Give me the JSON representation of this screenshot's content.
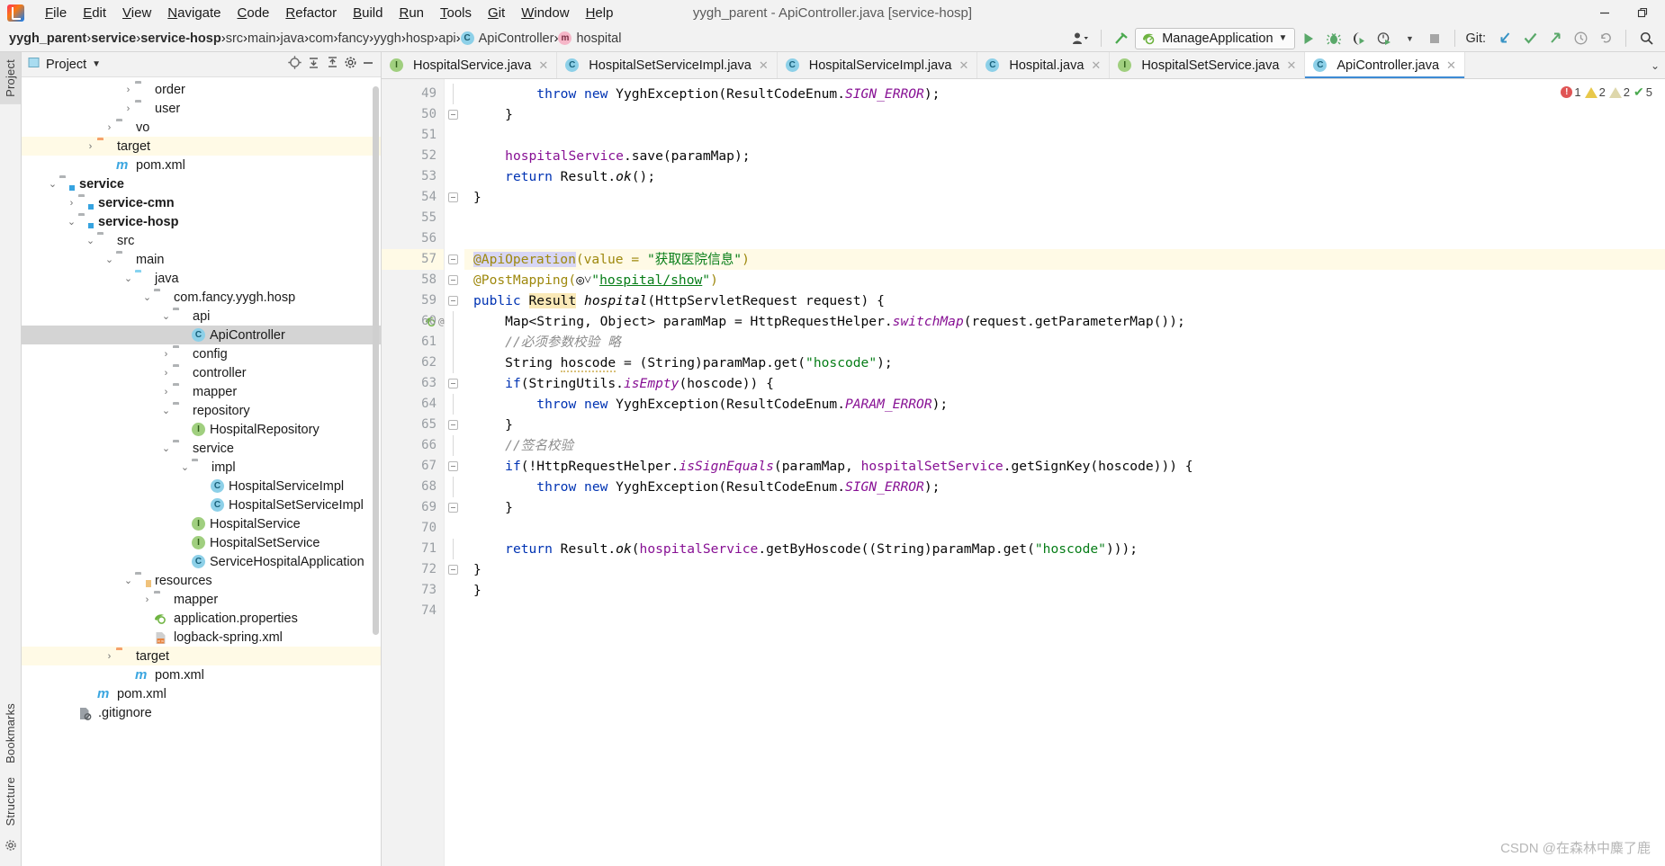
{
  "window": {
    "title": "yygh_parent - ApiController.java [service-hosp]",
    "minimize": "—",
    "maximize": "❐"
  },
  "menu": [
    "File",
    "Edit",
    "View",
    "Navigate",
    "Code",
    "Refactor",
    "Build",
    "Run",
    "Tools",
    "Git",
    "Window",
    "Help"
  ],
  "breadcrumb": [
    {
      "label": "yygh_parent",
      "bold": true
    },
    {
      "label": "service",
      "bold": true
    },
    {
      "label": "service-hosp",
      "bold": true
    },
    {
      "label": "src",
      "bold": false
    },
    {
      "label": "main",
      "bold": false
    },
    {
      "label": "java",
      "bold": false
    },
    {
      "label": "com",
      "bold": false
    },
    {
      "label": "fancy",
      "bold": false
    },
    {
      "label": "yygh",
      "bold": false
    },
    {
      "label": "hosp",
      "bold": false
    },
    {
      "label": "api",
      "bold": false
    },
    {
      "label": "ApiController",
      "bold": false,
      "icon": "class-icon"
    },
    {
      "label": "hospital",
      "bold": false,
      "icon": "method-icon"
    }
  ],
  "toolbar": {
    "run_config": "ManageApplication",
    "git_label": "Git:",
    "icons": [
      "person-dropdown-icon",
      "build-hammer-icon",
      "run-icon",
      "debug-icon",
      "run-coverage-icon",
      "profiler-icon",
      "dropdown-icon",
      "stop-icon",
      "git-update-icon",
      "git-commit-icon",
      "git-push-icon",
      "history-icon",
      "rollback-icon",
      "search-icon"
    ]
  },
  "project_panel": {
    "title": "Project",
    "tools": [
      "locate-icon",
      "collapse-all-icon",
      "expand-all-icon",
      "settings-icon",
      "hide-icon"
    ],
    "tree": [
      {
        "label": "order",
        "indent": 5,
        "type": "pkg",
        "arrow": "right"
      },
      {
        "label": "user",
        "indent": 5,
        "type": "pkg",
        "arrow": "right"
      },
      {
        "label": "vo",
        "indent": 4,
        "type": "pkg",
        "arrow": "right"
      },
      {
        "label": "target",
        "indent": 3,
        "type": "folder-orange",
        "arrow": "right",
        "highlight": true
      },
      {
        "label": "pom.xml",
        "indent": 4,
        "type": "maven",
        "arrow": "none"
      },
      {
        "label": "service",
        "indent": 1,
        "type": "module",
        "arrow": "down",
        "bold": true
      },
      {
        "label": "service-cmn",
        "indent": 2,
        "type": "module",
        "arrow": "right",
        "bold": true
      },
      {
        "label": "service-hosp",
        "indent": 2,
        "type": "module",
        "arrow": "down",
        "bold": true
      },
      {
        "label": "src",
        "indent": 3,
        "type": "folder",
        "arrow": "down"
      },
      {
        "label": "main",
        "indent": 4,
        "type": "folder",
        "arrow": "down"
      },
      {
        "label": "java",
        "indent": 5,
        "type": "folder-blue",
        "arrow": "down"
      },
      {
        "label": "com.fancy.yygh.hosp",
        "indent": 6,
        "type": "pkg",
        "arrow": "down"
      },
      {
        "label": "api",
        "indent": 7,
        "type": "pkg",
        "arrow": "down"
      },
      {
        "label": "ApiController",
        "indent": 8,
        "type": "class",
        "arrow": "none",
        "selected": true
      },
      {
        "label": "config",
        "indent": 7,
        "type": "pkg",
        "arrow": "right"
      },
      {
        "label": "controller",
        "indent": 7,
        "type": "pkg",
        "arrow": "right"
      },
      {
        "label": "mapper",
        "indent": 7,
        "type": "pkg",
        "arrow": "right"
      },
      {
        "label": "repository",
        "indent": 7,
        "type": "pkg",
        "arrow": "down"
      },
      {
        "label": "HospitalRepository",
        "indent": 8,
        "type": "interface",
        "arrow": "none"
      },
      {
        "label": "service",
        "indent": 7,
        "type": "pkg",
        "arrow": "down"
      },
      {
        "label": "impl",
        "indent": 8,
        "type": "pkg",
        "arrow": "down"
      },
      {
        "label": "HospitalServiceImpl",
        "indent": 9,
        "type": "class",
        "arrow": "none"
      },
      {
        "label": "HospitalSetServiceImpl",
        "indent": 9,
        "type": "class",
        "arrow": "none"
      },
      {
        "label": "HospitalService",
        "indent": 8,
        "type": "interface",
        "arrow": "none"
      },
      {
        "label": "HospitalSetService",
        "indent": 8,
        "type": "interface",
        "arrow": "none"
      },
      {
        "label": "ServiceHospitalApplication",
        "indent": 8,
        "type": "spring",
        "arrow": "none"
      },
      {
        "label": "resources",
        "indent": 5,
        "type": "folder-res",
        "arrow": "down"
      },
      {
        "label": "mapper",
        "indent": 6,
        "type": "folder",
        "arrow": "right"
      },
      {
        "label": "application.properties",
        "indent": 6,
        "type": "properties",
        "arrow": "none"
      },
      {
        "label": "logback-spring.xml",
        "indent": 6,
        "type": "xml",
        "arrow": "none"
      },
      {
        "label": "target",
        "indent": 4,
        "type": "folder-orange",
        "arrow": "right",
        "highlight": true
      },
      {
        "label": "pom.xml",
        "indent": 5,
        "type": "maven",
        "arrow": "none"
      },
      {
        "label": "pom.xml",
        "indent": 3,
        "type": "maven",
        "arrow": "none"
      },
      {
        "label": ".gitignore",
        "indent": 2,
        "type": "gitignore",
        "arrow": "none"
      }
    ]
  },
  "tool_tabs": {
    "left_top": "Project",
    "left_bottom_1": "Bookmarks",
    "left_bottom_2": "Structure"
  },
  "editor_tabs": [
    {
      "label": "HospitalService.java",
      "icon": "interface-icon",
      "active": false
    },
    {
      "label": "HospitalSetServiceImpl.java",
      "icon": "class-icon",
      "active": false
    },
    {
      "label": "HospitalServiceImpl.java",
      "icon": "class-icon",
      "active": false
    },
    {
      "label": "Hospital.java",
      "icon": "class-icon",
      "active": false
    },
    {
      "label": "HospitalSetService.java",
      "icon": "interface-icon",
      "active": false
    },
    {
      "label": "ApiController.java",
      "icon": "class-icon",
      "active": true
    }
  ],
  "inspections": {
    "errors": "1",
    "warnings": "2",
    "weak_warnings": "2",
    "checks": "5"
  },
  "code": {
    "first_line": 49,
    "lines": [
      {
        "n": 49,
        "fold": "line",
        "html": "        <span class='k'>throw</span> <span class='k'>new</span> YyghException(ResultCodeEnum.<span class='st'>SIGN_ERROR</span>);"
      },
      {
        "n": 50,
        "fold": "end",
        "html": "    }"
      },
      {
        "n": 51,
        "fold": "",
        "html": ""
      },
      {
        "n": 52,
        "fold": "",
        "html": "    <span class='fld'>hospitalService</span>.save(paramMap);"
      },
      {
        "n": 53,
        "fold": "",
        "html": "    <span class='k'>return</span> Result.<span class='mth'>ok</span>();"
      },
      {
        "n": 54,
        "fold": "end",
        "html": "}"
      },
      {
        "n": 55,
        "fold": "",
        "html": ""
      },
      {
        "n": 56,
        "fold": "",
        "html": ""
      },
      {
        "n": 57,
        "fold": "start",
        "hl": true,
        "html": "<span class='ann selbg'>@ApiOper</span><span class='caret'></span><span class='ann selbg'>ation</span><span class='ann'>(value = </span><span class='s'>\"获取医院信息\"</span><span class='ann'>)</span>"
      },
      {
        "n": 58,
        "fold": "start",
        "html": "<span class='ann'>@PostMapping(</span><span class='globe'>◎˅</span><span class='s'>\"</span><span class='ulink'>hospital/show</span><span class='s'>\"</span><span class='ann'>)</span>"
      },
      {
        "n": 59,
        "fold": "start",
        "gutter": "run-spring",
        "html": "<span class='k'>public</span> <span class='hlt'>Result</span> <span class='mth'>hospital</span>(HttpServletRequest request) {"
      },
      {
        "n": 60,
        "fold": "line",
        "html": "    Map&lt;String, Object&gt; paramMap = HttpRequestHelper.<span class='st'>switchMap</span>(request.getParameterMap());"
      },
      {
        "n": 61,
        "fold": "line",
        "html": "    <span class='cm'>//必须参数校验 略</span>"
      },
      {
        "n": 62,
        "fold": "line",
        "html": "    String <span class='warnwave'>hoscode</span> = (String)paramMap.get(<span class='s'>\"hoscode\"</span>);"
      },
      {
        "n": 63,
        "fold": "start",
        "html": "    <span class='k'>if</span>(StringUtils.<span class='st'>isEmpty</span>(hoscode)) {"
      },
      {
        "n": 64,
        "fold": "line",
        "html": "        <span class='k'>throw</span> <span class='k'>new</span> YyghException(ResultCodeEnum.<span class='st'>PARAM_ERROR</span>);"
      },
      {
        "n": 65,
        "fold": "end",
        "html": "    }"
      },
      {
        "n": 66,
        "fold": "line",
        "html": "    <span class='cm'>//签名校验</span>"
      },
      {
        "n": 67,
        "fold": "start",
        "html": "    <span class='k'>if</span>(!HttpRequestHelper.<span class='st'>isSignEquals</span>(paramMap, <span class='fld'>hospitalSetService</span>.getSignKey(hoscode))) {"
      },
      {
        "n": 68,
        "fold": "line",
        "html": "        <span class='k'>throw</span> <span class='k'>new</span> YyghException(ResultCodeEnum.<span class='st'>SIGN_ERROR</span>);"
      },
      {
        "n": 69,
        "fold": "end",
        "html": "    }"
      },
      {
        "n": 70,
        "fold": "",
        "html": ""
      },
      {
        "n": 71,
        "fold": "line",
        "html": "    <span class='k'>return</span> Result.<span class='mth'>ok</span>(<span class='fld'>hospitalService</span>.getByHoscode((String)paramMap.get(<span class='s'>\"hoscode\"</span>)));"
      },
      {
        "n": 72,
        "fold": "end",
        "html": "}"
      },
      {
        "n": 73,
        "fold": "",
        "html": "}",
        "outdent": true
      },
      {
        "n": 74,
        "fold": "",
        "html": ""
      }
    ]
  },
  "watermark": "CSDN @在森林中麋了鹿",
  "colors": {
    "accent": "#3d8bd4",
    "keyword": "#0033b3",
    "string": "#067d17",
    "annotation": "#9e880d",
    "comment": "#8c8c8c",
    "field": "#871094",
    "highlight_row": "#fffae6",
    "selection": "#d4d4d4"
  }
}
